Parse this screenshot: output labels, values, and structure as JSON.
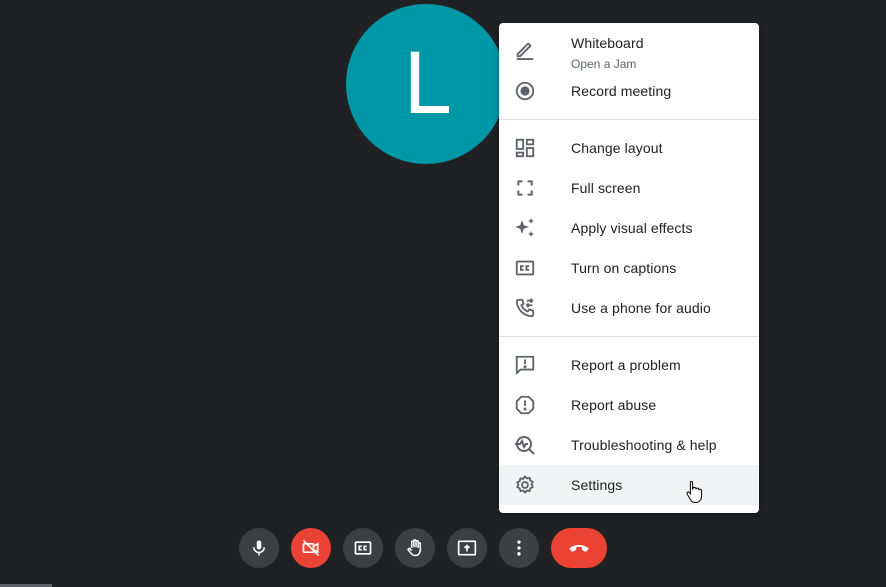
{
  "avatar": {
    "letter": "L",
    "color": "#0097a7"
  },
  "menu": {
    "whiteboard": {
      "label": "Whiteboard",
      "sub": "Open a Jam",
      "icon": "pencil-icon"
    },
    "record": {
      "label": "Record meeting",
      "icon": "record-icon"
    },
    "layout": {
      "label": "Change layout",
      "icon": "layout-icon"
    },
    "fullscreen": {
      "label": "Full screen",
      "icon": "fullscreen-icon"
    },
    "effects": {
      "label": "Apply visual effects",
      "icon": "sparkle-icon"
    },
    "captions": {
      "label": "Turn on captions",
      "icon": "cc-icon"
    },
    "phone": {
      "label": "Use a phone for audio",
      "icon": "phone-icon"
    },
    "report_problem": {
      "label": "Report a problem",
      "icon": "feedback-icon"
    },
    "report_abuse": {
      "label": "Report abuse",
      "icon": "alert-icon"
    },
    "troubleshoot": {
      "label": "Troubleshooting & help",
      "icon": "troubleshoot-icon"
    },
    "settings": {
      "label": "Settings",
      "icon": "gear-icon"
    }
  },
  "toolbar": {
    "buttons": [
      "mic-icon",
      "camera-off-icon",
      "cc-icon",
      "raise-hand-icon",
      "present-icon",
      "more-vert-icon",
      "end-call-icon"
    ],
    "danger_color": "#ea4335"
  }
}
